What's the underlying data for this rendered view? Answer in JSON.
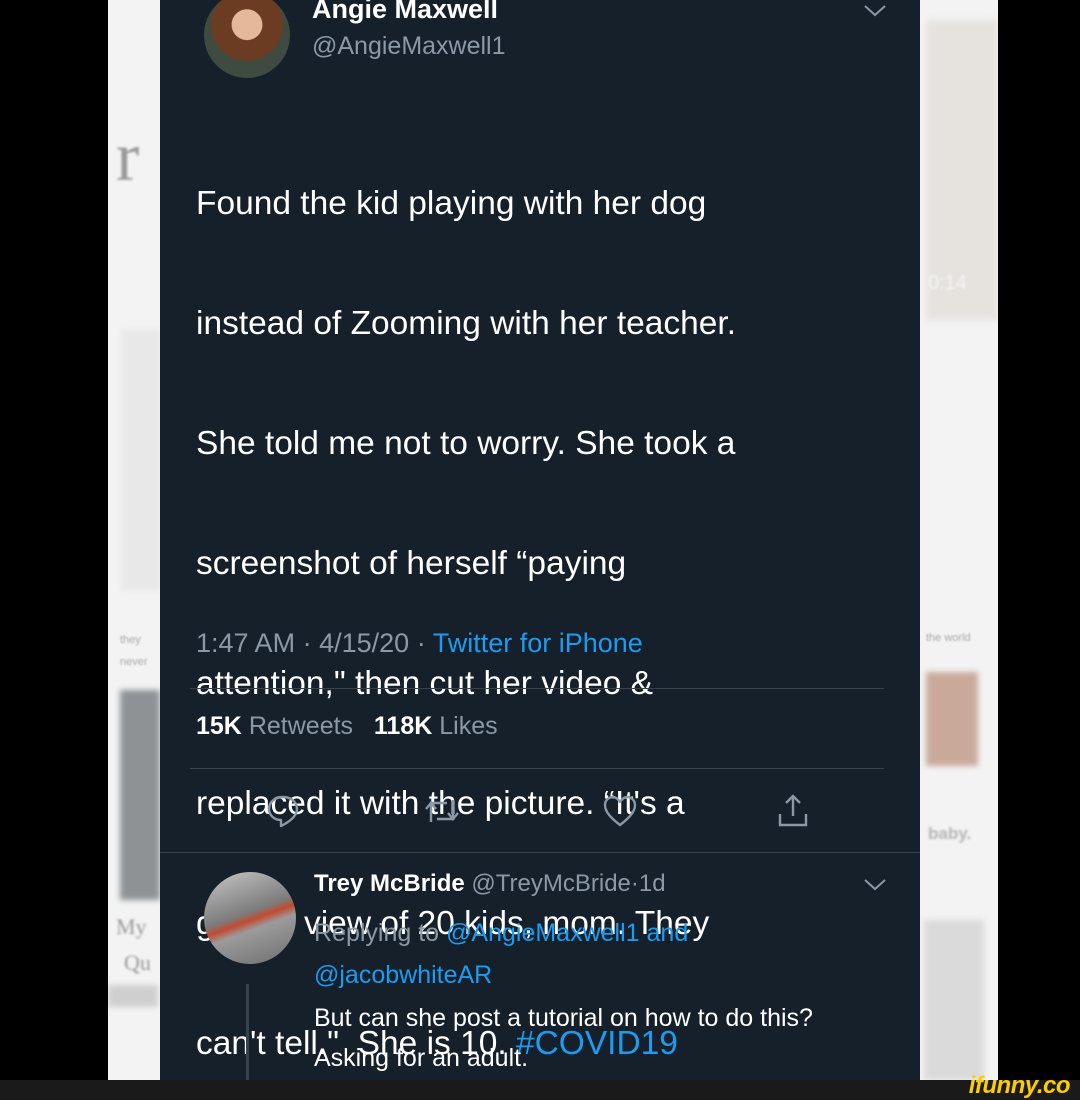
{
  "tweet": {
    "author_name": "Angie Maxwell",
    "author_handle": "@AngieMaxwell1",
    "text_lines": [
      "Found the kid playing with her dog",
      "instead of Zooming with her teacher.",
      "She told me not to worry. She took a",
      "screenshot of herself “paying",
      "attention,\" then cut her video &",
      "replaced it with the picture. “It's a",
      "gallery view of 20 kids, mom. They",
      "can't tell.\"  She is 10. "
    ],
    "hashtag": "#COVID19",
    "time": "1:47 AM",
    "date": "4/15/20",
    "separator": "·",
    "source": "Twitter for iPhone",
    "retweets_count": "15K",
    "retweets_label": "Retweets",
    "likes_count": "118K",
    "likes_label": "Likes"
  },
  "actions": {
    "reply_icon": "reply-icon",
    "retweet_icon": "retweet-icon",
    "like_icon": "heart-icon",
    "share_icon": "share-icon"
  },
  "reply": {
    "author_name": "Trey McBride",
    "author_handle": "@TreyMcBride",
    "age": "1d",
    "replying_prefix": "Replying to ",
    "mention_1": "@AngieMaxwell1",
    "and_word": " and",
    "mention_2": "@jacobwhiteAR",
    "body": "But can she post a tutorial on how to do this? Asking for an adult."
  },
  "background": {
    "letter": "r",
    "timer": "0:14",
    "word_1": "baby.",
    "word_2": "My",
    "word_3": "Qu",
    "small_1": "they",
    "small_2": "never",
    "small_3": "the world"
  },
  "watermark": "ifunny.co",
  "colors": {
    "card_bg": "#15202b",
    "accent": "#1d9bf0",
    "muted": "#8b98a5",
    "watermark": "#ffcc00"
  }
}
